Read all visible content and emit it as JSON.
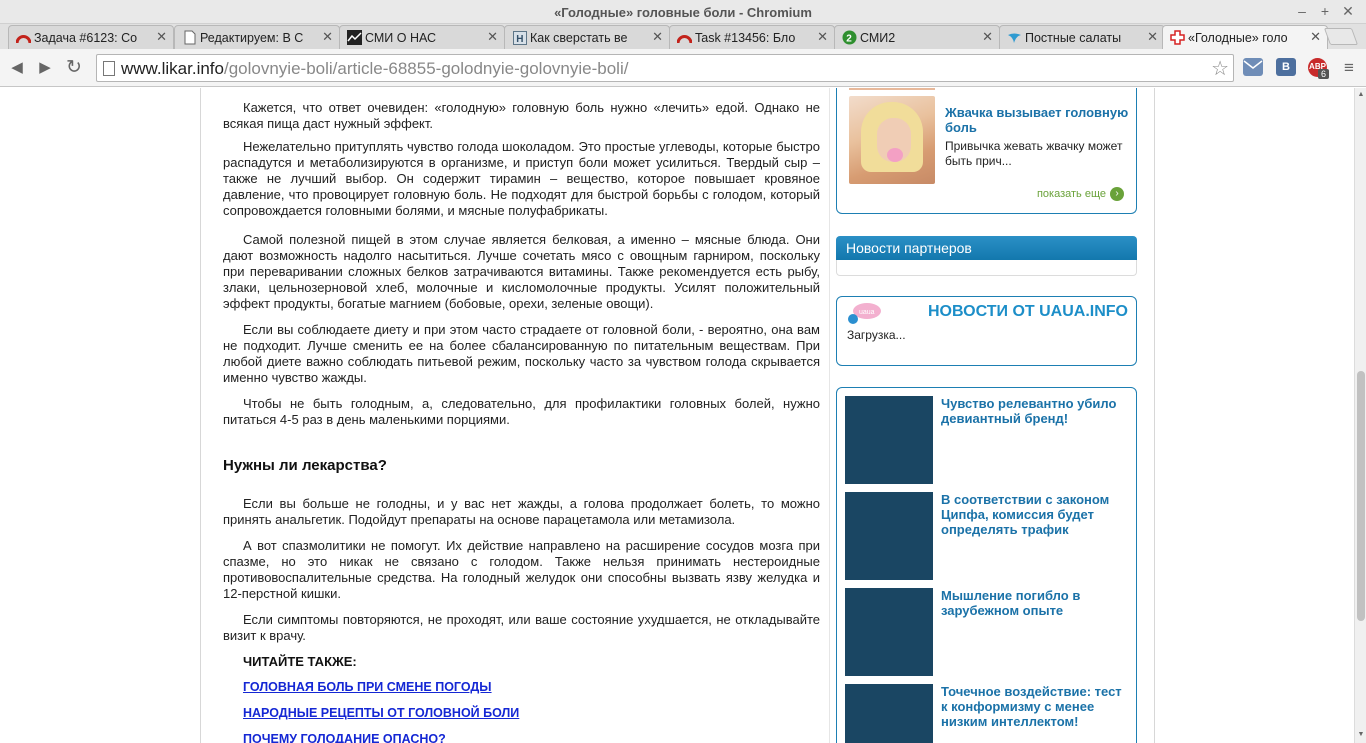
{
  "window": {
    "title": "«Голодные» головные боли - Chromium",
    "controls": [
      "–",
      "+",
      "✕"
    ]
  },
  "tabs": [
    {
      "label": "Задача #6123: Со",
      "icon": "redmine-icon",
      "active": false
    },
    {
      "label": "Редактируем: В С",
      "icon": "page-icon",
      "active": false
    },
    {
      "label": "СМИ О НАС",
      "icon": "chart-icon",
      "active": false
    },
    {
      "label": "Как сверстать ве",
      "icon": "h-icon",
      "active": false
    },
    {
      "label": "Task #13456: Бло",
      "icon": "redmine-icon",
      "active": false
    },
    {
      "label": "СМИ2",
      "icon": "smi2-icon",
      "active": false
    },
    {
      "label": "Постные салаты",
      "icon": "bird-icon",
      "active": false
    },
    {
      "label": "«Голодные» голо",
      "icon": "red-cross-icon",
      "active": true
    }
  ],
  "toolbar": {
    "url_domain": "www.likar.info",
    "url_path": "/golovnyie-boli/article-68855-golodnyie-golovnyie-boli/",
    "abp_count": "6",
    "vk_label": "В"
  },
  "article": {
    "paragraphs": [
      "Кажется, что ответ очевиден: «голодную» головную боль нужно «лечить» едой. Однако не всякая пища даст нужный эффект.",
      "Нежелательно притуплять чувство голода шоколадом. Это простые углеводы, которые быстро распадутся и метаболизируются в организме, и приступ боли может усилиться. Твердый сыр – также не лучший выбор. Он содержит тирамин – вещество, которое повышает кровяное давление, что провоцирует головную боль. Не подходят для быстрой борьбы с голодом, который сопровождается головными болями, и мясные полуфабрикаты.",
      "Самой полезной пищей в этом случае является белковая, а именно – мясные блюда. Они дают возможность надолго насытиться. Лучше сочетать мясо с овощным гарниром, поскольку при переваривании сложных белков затрачиваются витамины. Также рекомендуется есть рыбу, злаки, цельнозерновой хлеб, молочные и кисломолочные продукты. Усилят положительный эффект продукты, богатые магнием (бобовые, орехи, зеленые овощи).",
      "Если вы соблюдаете диету и при этом часто страдаете от головной боли, - вероятно, она вам не подходит. Лучше сменить ее на более сбалансированную по питательным веществам. При любой диете важно соблюдать питьевой режим, поскольку часто за чувством голода скрывается именно чувство жажды.",
      "Чтобы не быть голодным, а, следовательно, для профилактики головных болей, нужно питаться 4-5 раз в день маленькими порциями."
    ],
    "heading": "Нужны ли лекарства?",
    "paragraphs2": [
      "Если вы больше не голодны, и у вас нет жажды, а голова продолжает болеть, то можно принять анальгетик. Подойдут препараты на основе парацетамола или метамизола.",
      "А вот спазмолитики не помогут. Их действие направлено на расширение сосудов мозга при спазме, но это никак не связано с голодом. Также нельзя принимать нестероидные противовоспалительные средства. На голодный желудок они способны вызвать язву желудка и 12-перстной кишки.",
      "Если симптомы повторяются, не проходят, или ваше состояние ухудшается, не откладывайте визит к врачу."
    ],
    "read_also": "ЧИТАЙТЕ ТАКЖЕ:",
    "links": [
      "ГОЛОВНАЯ БОЛЬ ПРИ СМЕНЕ ПОГОДЫ",
      "НАРОДНЫЕ РЕЦЕПТЫ ОТ ГОЛОВНОЙ БОЛИ",
      "ПОЧЕМУ ГОЛОДАНИЕ ОПАСНО?"
    ]
  },
  "sidebar": {
    "teaser": {
      "title": "Жвачка вызывает головную боль",
      "desc": "Привычка жевать жвачку может быть прич...",
      "show_more": "показать еще"
    },
    "partners_title": "Новости партнеров",
    "uaua": {
      "title": "НОВОСТИ ОТ UAUA.INFO",
      "loading": "Загрузка...",
      "logo_text": "uaua"
    },
    "ads": [
      "Чувство релевантно убило девиантный бренд!",
      "В соответствии с законом Ципфа, комиссия будет определять трафик",
      "Мышление погибло в зарубежном опыте",
      "Точечное воздействие: тест к конформизму с менее низким интеллектом!"
    ]
  },
  "colors": {
    "link_blue": "#1427d4",
    "sidebar_blue": "#1b72a8",
    "partners_header": "#1e85bb",
    "ad_image": "#1a4663",
    "show_more_green": "#6aa23a"
  }
}
